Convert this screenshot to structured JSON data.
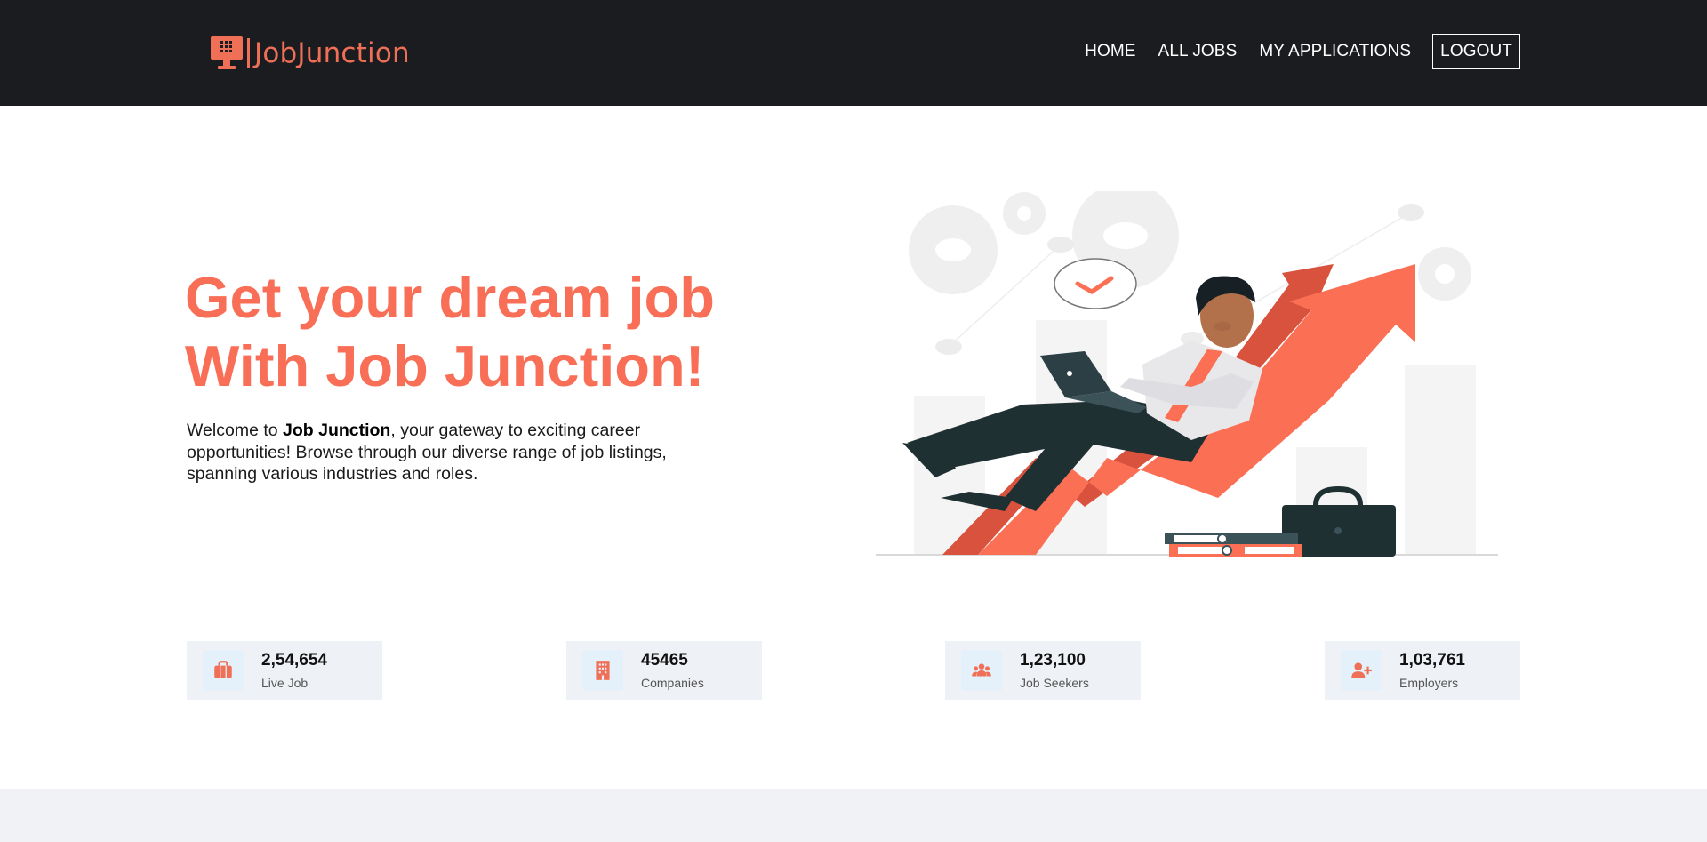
{
  "brand": {
    "name": "JobJunction",
    "color": "#f07057"
  },
  "nav": {
    "items": [
      {
        "label": "HOME"
      },
      {
        "label": "ALL JOBS"
      },
      {
        "label": "MY APPLICATIONS"
      }
    ],
    "logout_label": "LOGOUT"
  },
  "hero": {
    "title_line1": "Get your dream job",
    "title_line2": "With Job Junction!",
    "intro_prefix": "Welcome to ",
    "intro_brand": "Job Junction",
    "intro_suffix": ", your gateway to exciting career opportunities! Browse through our diverse range of job listings, spanning various industries and roles."
  },
  "stats": [
    {
      "value": "2,54,654",
      "label": "Live Job",
      "icon": "briefcase-icon"
    },
    {
      "value": "45465",
      "label": "Companies",
      "icon": "building-icon"
    },
    {
      "value": "1,23,100",
      "label": "Job Seekers",
      "icon": "users-icon"
    },
    {
      "value": "1,03,761",
      "label": "Employers",
      "icon": "user-plus-icon"
    }
  ],
  "colors": {
    "accent": "#f96e56",
    "navbar": "#1b1c20",
    "stat_bg": "#eef1f5",
    "icon_bg": "#e4f0fa"
  }
}
